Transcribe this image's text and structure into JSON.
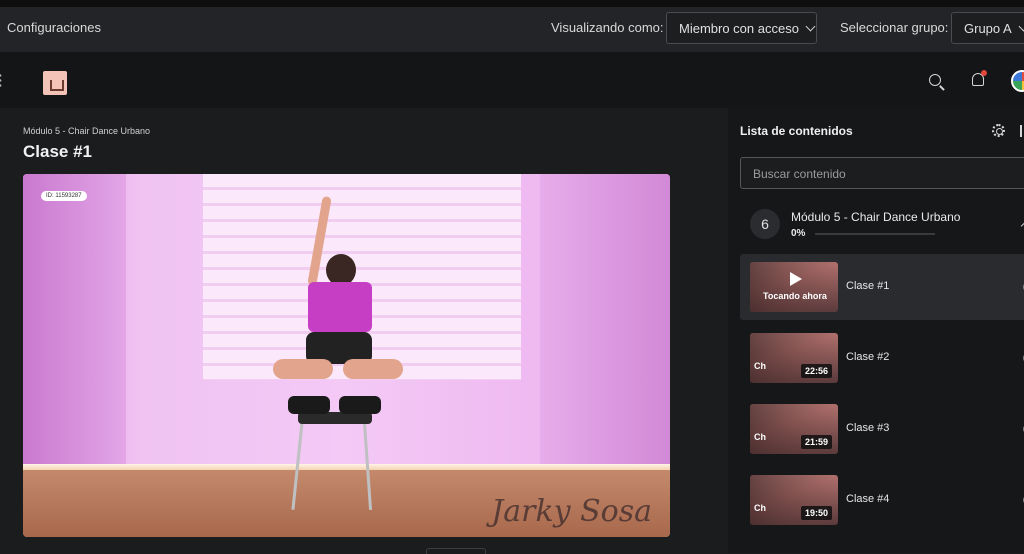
{
  "topbar": {
    "title": "Configuraciones",
    "viewing_label": "Visualizando como:",
    "viewing_value": "Miembro con acceso",
    "group_label": "Seleccionar grupo:",
    "group_value": "Grupo A"
  },
  "navbar": {
    "icons": [
      "menu-icon",
      "logo",
      "search-icon",
      "bell-icon",
      "avatar"
    ]
  },
  "main": {
    "breadcrumb": "Módulo 5 - Chair Dance Urbano",
    "title": "Clase #1",
    "video": {
      "id_badge": "ID: 11593287",
      "signature": "Jarky Sosa"
    }
  },
  "sidebar": {
    "title": "Lista de contenidos",
    "search_placeholder": "Buscar contenido",
    "module": {
      "number": "6",
      "title": "Módulo 5 - Chair Dance Urbano",
      "progress": "0%"
    },
    "lessons": [
      {
        "title": "Clase #1",
        "status": "Tocando ahora",
        "duration": ""
      },
      {
        "title": "Clase #2",
        "status": "",
        "duration": "22:56",
        "overlay": "Ch"
      },
      {
        "title": "Clase #3",
        "status": "",
        "duration": "21:59",
        "overlay": "Ch"
      },
      {
        "title": "Clase #4",
        "status": "",
        "duration": "19:50",
        "overlay": "Ch"
      }
    ]
  }
}
